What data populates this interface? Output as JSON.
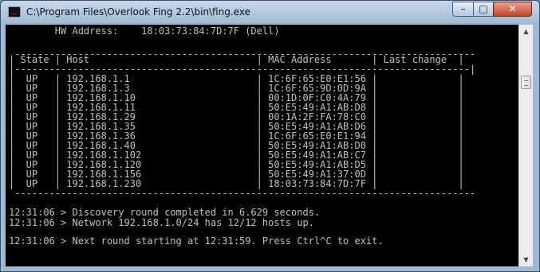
{
  "window": {
    "title": "C:\\Program Files\\Overlook Fing 2.2\\bin\\fing.exe",
    "controls": {
      "minimize": "–",
      "maximize": "□",
      "close": "✕"
    },
    "icon": "console-icon"
  },
  "console": {
    "hw_line": "        HW Address:    18:03:73:84:7D:7F (Dell)",
    "table_border": " -------------------------------------------------------------------------------- ",
    "header_line": "| State | Host                             | MAC Address       | Last change  |",
    "separator_line": "|-------------------------------------------------------------------------------|",
    "rows": [
      "|  UP   | 192.168.1.1                      | 1C:6F:65:E0:E1:56 |              |",
      "|  UP   | 192.168.1.3                      | 1C:6F:65:9D:0D:9A |              |",
      "|  UP   | 192.168.1.10                     | 00:1D:0F:C0:4A:79 |              |",
      "|  UP   | 192.168.1.11                     | 50:E5:49:A1:AB:D8 |              |",
      "|  UP   | 192.168.1.29                     | 00:1A:2F:FA:78:C0 |              |",
      "|  UP   | 192.168.1.35                     | 50:E5:49:A1:AB:D6 |              |",
      "|  UP   | 192.168.1.36                     | 1C:6F:65:E0:E1:94 |              |",
      "|  UP   | 192.168.1.40                     | 50:E5:49:A1:AB:D0 |              |",
      "|  UP   | 192.168.1.102                    | 50:E5:49:A1:AB:C7 |              |",
      "|  UP   | 192.168.1.120                    | 50:E5:49:A1:AB:D5 |              |",
      "|  UP   | 192.168.1.156                    | 50:E5:49:A1:37:0D |              |",
      "|  UP   | 192.168.1.230                    | 18:03:73:84:7D:7F |              |"
    ],
    "messages": [
      "12:31:06 > Discovery round completed in 6.629 seconds.",
      "12:31:06 > Network 192.168.1.0/24 has 12/12 hosts up.",
      "12:31:06 > Next round starting at 12:31:59. Press Ctrl^C to exit."
    ]
  },
  "colors": {
    "console_bg": "#000000",
    "console_text": "#c0c0c0",
    "close_button": "#c7432a"
  }
}
